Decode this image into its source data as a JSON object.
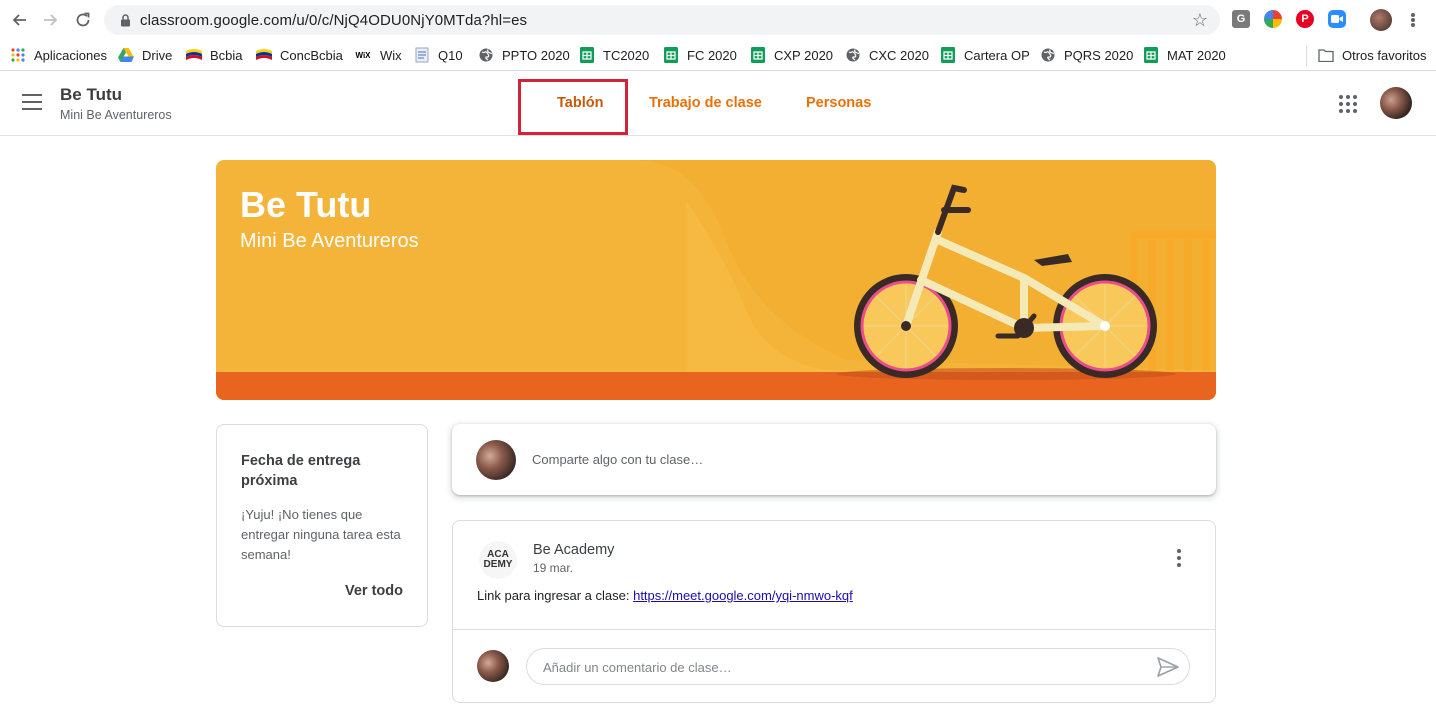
{
  "browser": {
    "url": "classroom.google.com/u/0/c/NjQ4ODU0NjY0MTda?hl=es",
    "extensions": [
      {
        "icon": "g-extension-icon",
        "label": "G"
      },
      {
        "icon": "chrome-color-icon",
        "label": ""
      },
      {
        "icon": "pinterest-icon",
        "label": "P"
      },
      {
        "icon": "zoom-icon",
        "label": ""
      }
    ],
    "bookmarks": [
      {
        "label": "Aplicaciones",
        "icon": "apps-grid-icon"
      },
      {
        "label": "Drive",
        "icon": "drive-icon"
      },
      {
        "label": "Bcbia",
        "icon": "flag-icon"
      },
      {
        "label": "ConcBcbia",
        "icon": "flag-icon"
      },
      {
        "label": "Wix",
        "icon": "wix-icon"
      },
      {
        "label": "Q10",
        "icon": "doc-icon"
      },
      {
        "label": "PPTO 2020",
        "icon": "globe-icon"
      },
      {
        "label": "TC2020",
        "icon": "sheets-icon"
      },
      {
        "label": "FC 2020",
        "icon": "sheets-icon"
      },
      {
        "label": "CXP 2020",
        "icon": "sheets-icon"
      },
      {
        "label": "CXC 2020",
        "icon": "globe-icon"
      },
      {
        "label": "Cartera OP",
        "icon": "sheets-icon"
      },
      {
        "label": "PQRS 2020",
        "icon": "globe-icon"
      },
      {
        "label": "MAT 2020",
        "icon": "sheets-icon"
      }
    ],
    "other_bookmarks": "Otros favoritos",
    "wix_glyph": "WiX"
  },
  "header": {
    "class_name": "Be Tutu",
    "section": "Mini Be Aventureros",
    "tabs": [
      {
        "label": "Tablón",
        "active": true
      },
      {
        "label": "Trabajo de clase",
        "active": false
      },
      {
        "label": "Personas",
        "active": false
      }
    ]
  },
  "banner": {
    "title": "Be Tutu",
    "subtitle": "Mini Be Aventureros"
  },
  "upcoming": {
    "heading": "Fecha de entrega próxima",
    "message": "¡Yuju! ¡No tienes que entregar ninguna tarea esta semana!",
    "view_all": "Ver todo"
  },
  "share": {
    "placeholder": "Comparte algo con tu clase…"
  },
  "post": {
    "logo_text_top": "ACA",
    "logo_text_bottom": "DEMY",
    "author": "Be Academy",
    "date": "19 mar.",
    "body_prefix": "Link para ingresar a clase: ",
    "link": "https://meet.google.com/yqi-nmwo-kqf",
    "comment_placeholder": "Añadir un comentario de clase…"
  },
  "colors": {
    "accent": "#e8710a",
    "banner": "#f4b43a",
    "highlight": "#d1243a"
  }
}
